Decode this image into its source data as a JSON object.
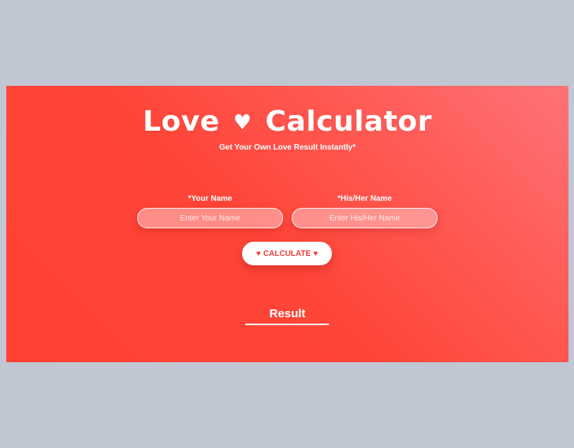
{
  "header": {
    "title_part1": "Love",
    "title_heart": "♥",
    "title_part2": "Calculator",
    "subtitle": "Get Your Own Love Result Instantly*"
  },
  "form": {
    "your_name_label": "*Your Name",
    "your_name_placeholder": "Enter Your Name",
    "your_name_value": "",
    "their_name_label": "*His/Her Name",
    "their_name_placeholder": "Enter His/Her Name",
    "their_name_value": ""
  },
  "calculate_button": {
    "heart_left": "♥",
    "label": "CALCULATE",
    "heart_right": "♥"
  },
  "result": {
    "label": "Result"
  },
  "colors": {
    "page_background": "#c0c7d3",
    "card_gradient_start": "#ff7377",
    "card_gradient_end": "#ff4133",
    "button_text": "#f23b34",
    "text": "#ffffff"
  }
}
